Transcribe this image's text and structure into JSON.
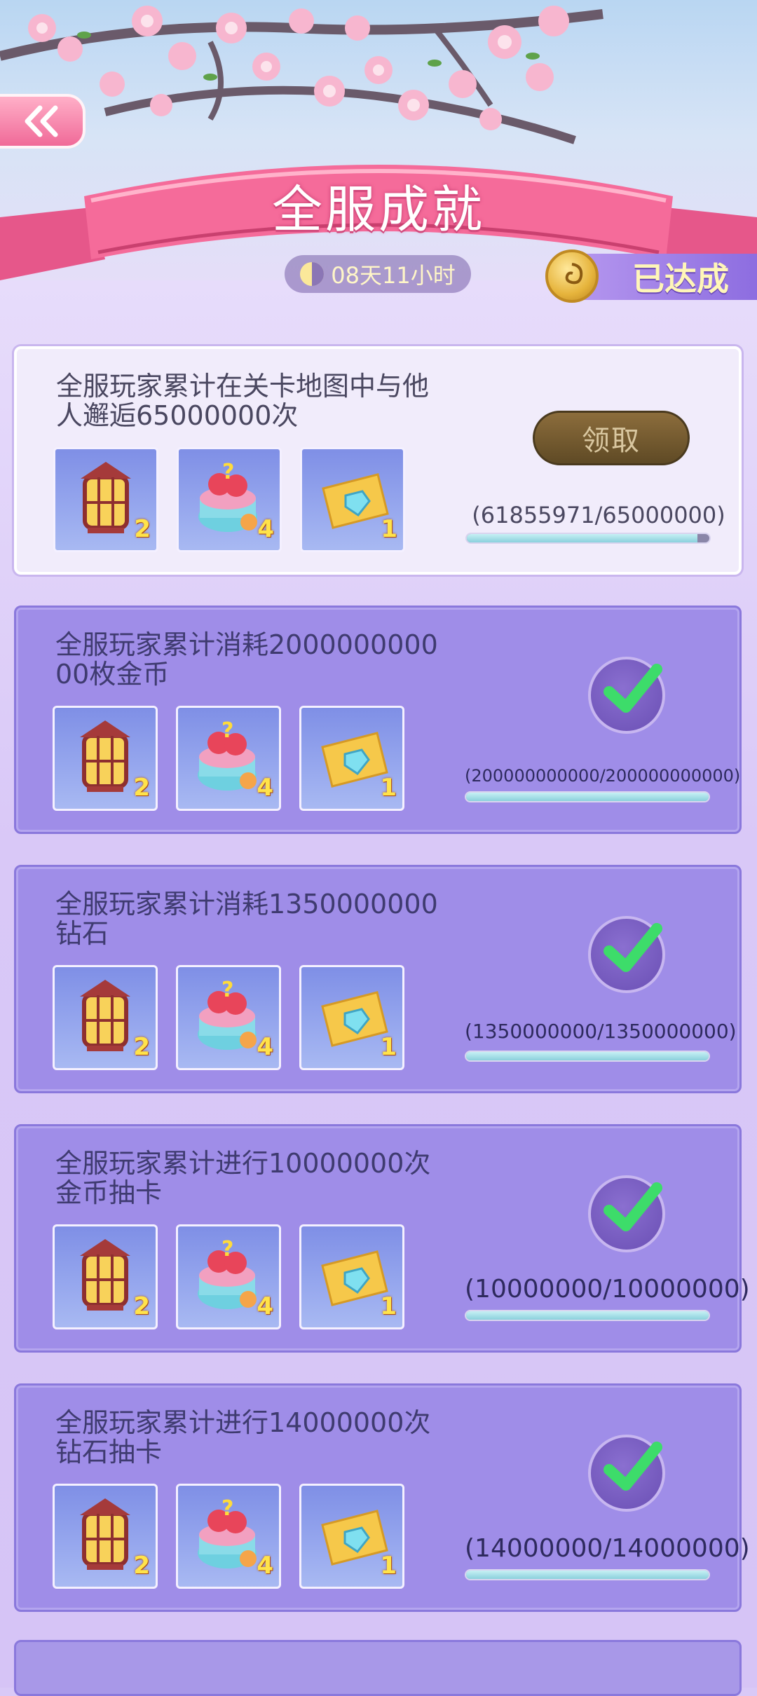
{
  "header": {
    "title": "全服成就",
    "timer": "08天11小时",
    "achieved_label": "已达成"
  },
  "achievements": [
    {
      "description": "全服玩家累计在关卡地图中与他人邂逅65000000次",
      "status": "claimable",
      "claim_label": "领取",
      "progress_text": "(61855971/65000000)",
      "progress": 0.9516,
      "rewards": [
        {
          "icon": "lantern-icon",
          "count": "2"
        },
        {
          "icon": "mystery-gift-box-icon",
          "count": "4"
        },
        {
          "icon": "diamond-ticket-icon",
          "count": "1"
        }
      ]
    },
    {
      "description": "全服玩家累计消耗200000000000枚金币",
      "status": "completed",
      "progress_text": "(200000000000/200000000000)",
      "progress": 1.0,
      "rewards": [
        {
          "icon": "lantern-icon",
          "count": "2"
        },
        {
          "icon": "mystery-gift-box-icon",
          "count": "4"
        },
        {
          "icon": "diamond-ticket-icon",
          "count": "1"
        }
      ]
    },
    {
      "description": "全服玩家累计消耗1350000000钻石",
      "status": "completed",
      "progress_text": "(1350000000/1350000000)",
      "progress": 1.0,
      "rewards": [
        {
          "icon": "lantern-icon",
          "count": "2"
        },
        {
          "icon": "mystery-gift-box-icon",
          "count": "4"
        },
        {
          "icon": "diamond-ticket-icon",
          "count": "1"
        }
      ]
    },
    {
      "description": "全服玩家累计进行10000000次金币抽卡",
      "status": "completed",
      "progress_text": "(10000000/10000000)",
      "progress": 1.0,
      "rewards": [
        {
          "icon": "lantern-icon",
          "count": "2"
        },
        {
          "icon": "mystery-gift-box-icon",
          "count": "4"
        },
        {
          "icon": "diamond-ticket-icon",
          "count": "1"
        }
      ]
    },
    {
      "description": "全服玩家累计进行14000000次钻石抽卡",
      "status": "completed",
      "progress_text": "(14000000/14000000)",
      "progress": 1.0,
      "rewards": [
        {
          "icon": "lantern-icon",
          "count": "2"
        },
        {
          "icon": "mystery-gift-box-icon",
          "count": "4"
        },
        {
          "icon": "diamond-ticket-icon",
          "count": "1"
        }
      ]
    }
  ]
}
